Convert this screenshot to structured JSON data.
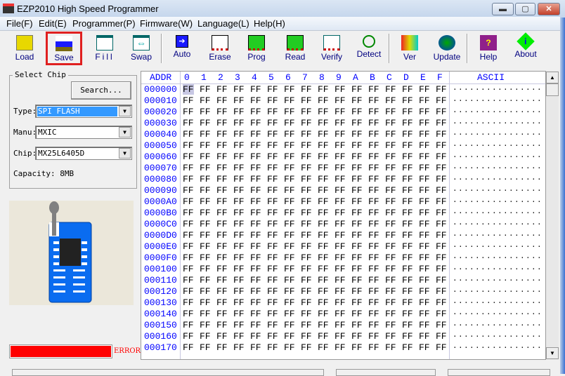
{
  "window": {
    "title": "EZP2010 High Speed Programmer",
    "minimize": "▬",
    "maximize": "▢",
    "close": "✕"
  },
  "menu": [
    "File(F)",
    "Edit(E)",
    "Programmer(P)",
    "Firmware(W)",
    "Language(L)",
    "Help(H)"
  ],
  "toolbar": [
    "Load",
    "Save",
    "Fill",
    "Swap",
    "Auto",
    "Erase",
    "Prog",
    "Read",
    "Verify",
    "Detect",
    "Ver",
    "Update",
    "Help",
    "About"
  ],
  "select_chip": {
    "legend": "Select Chip",
    "search": "Search...",
    "type_label": "Type:",
    "type_value": "SPI FLASH",
    "manu_label": "Manu:",
    "manu_value": "MXIC",
    "chip_label": "Chip:",
    "chip_value": "MX25L6405D",
    "capacity": "Capacity: 8MB"
  },
  "status": {
    "progress": 100,
    "text": "ERROR",
    "color": "#ff0000"
  },
  "hex": {
    "addr_header": "ADDR",
    "columns": [
      "0",
      "1",
      "2",
      "3",
      "4",
      "5",
      "6",
      "7",
      "8",
      "9",
      "A",
      "B",
      "C",
      "D",
      "E",
      "F"
    ],
    "ascii_header": "ASCII",
    "rows": [
      {
        "addr": "000000",
        "bytes": "FF FF FF FF FF FF FF FF FF FF FF FF FF FF FF FF",
        "ascii": "................"
      },
      {
        "addr": "000010",
        "bytes": "FF FF FF FF FF FF FF FF FF FF FF FF FF FF FF FF",
        "ascii": "................"
      },
      {
        "addr": "000020",
        "bytes": "FF FF FF FF FF FF FF FF FF FF FF FF FF FF FF FF",
        "ascii": "................"
      },
      {
        "addr": "000030",
        "bytes": "FF FF FF FF FF FF FF FF FF FF FF FF FF FF FF FF",
        "ascii": "................"
      },
      {
        "addr": "000040",
        "bytes": "FF FF FF FF FF FF FF FF FF FF FF FF FF FF FF FF",
        "ascii": "................"
      },
      {
        "addr": "000050",
        "bytes": "FF FF FF FF FF FF FF FF FF FF FF FF FF FF FF FF",
        "ascii": "................"
      },
      {
        "addr": "000060",
        "bytes": "FF FF FF FF FF FF FF FF FF FF FF FF FF FF FF FF",
        "ascii": "................"
      },
      {
        "addr": "000070",
        "bytes": "FF FF FF FF FF FF FF FF FF FF FF FF FF FF FF FF",
        "ascii": "................"
      },
      {
        "addr": "000080",
        "bytes": "FF FF FF FF FF FF FF FF FF FF FF FF FF FF FF FF",
        "ascii": "................"
      },
      {
        "addr": "000090",
        "bytes": "FF FF FF FF FF FF FF FF FF FF FF FF FF FF FF FF",
        "ascii": "................"
      },
      {
        "addr": "0000A0",
        "bytes": "FF FF FF FF FF FF FF FF FF FF FF FF FF FF FF FF",
        "ascii": "................"
      },
      {
        "addr": "0000B0",
        "bytes": "FF FF FF FF FF FF FF FF FF FF FF FF FF FF FF FF",
        "ascii": "................"
      },
      {
        "addr": "0000C0",
        "bytes": "FF FF FF FF FF FF FF FF FF FF FF FF FF FF FF FF",
        "ascii": "................"
      },
      {
        "addr": "0000D0",
        "bytes": "FF FF FF FF FF FF FF FF FF FF FF FF FF FF FF FF",
        "ascii": "................"
      },
      {
        "addr": "0000E0",
        "bytes": "FF FF FF FF FF FF FF FF FF FF FF FF FF FF FF FF",
        "ascii": "................"
      },
      {
        "addr": "0000F0",
        "bytes": "FF FF FF FF FF FF FF FF FF FF FF FF FF FF FF FF",
        "ascii": "................"
      },
      {
        "addr": "000100",
        "bytes": "FF FF FF FF FF FF FF FF FF FF FF FF FF FF FF FF",
        "ascii": "................"
      },
      {
        "addr": "000110",
        "bytes": "FF FF FF FF FF FF FF FF FF FF FF FF FF FF FF FF",
        "ascii": "................"
      },
      {
        "addr": "000120",
        "bytes": "FF FF FF FF FF FF FF FF FF FF FF FF FF FF FF FF",
        "ascii": "................"
      },
      {
        "addr": "000130",
        "bytes": "FF FF FF FF FF FF FF FF FF FF FF FF FF FF FF FF",
        "ascii": "................"
      },
      {
        "addr": "000140",
        "bytes": "FF FF FF FF FF FF FF FF FF FF FF FF FF FF FF FF",
        "ascii": "................"
      },
      {
        "addr": "000150",
        "bytes": "FF FF FF FF FF FF FF FF FF FF FF FF FF FF FF FF",
        "ascii": "................"
      },
      {
        "addr": "000160",
        "bytes": "FF FF FF FF FF FF FF FF FF FF FF FF FF FF FF FF",
        "ascii": "................"
      },
      {
        "addr": "000170",
        "bytes": "FF FF FF FF FF FF FF FF FF FF FF FF FF FF FF FF",
        "ascii": "................"
      }
    ]
  }
}
